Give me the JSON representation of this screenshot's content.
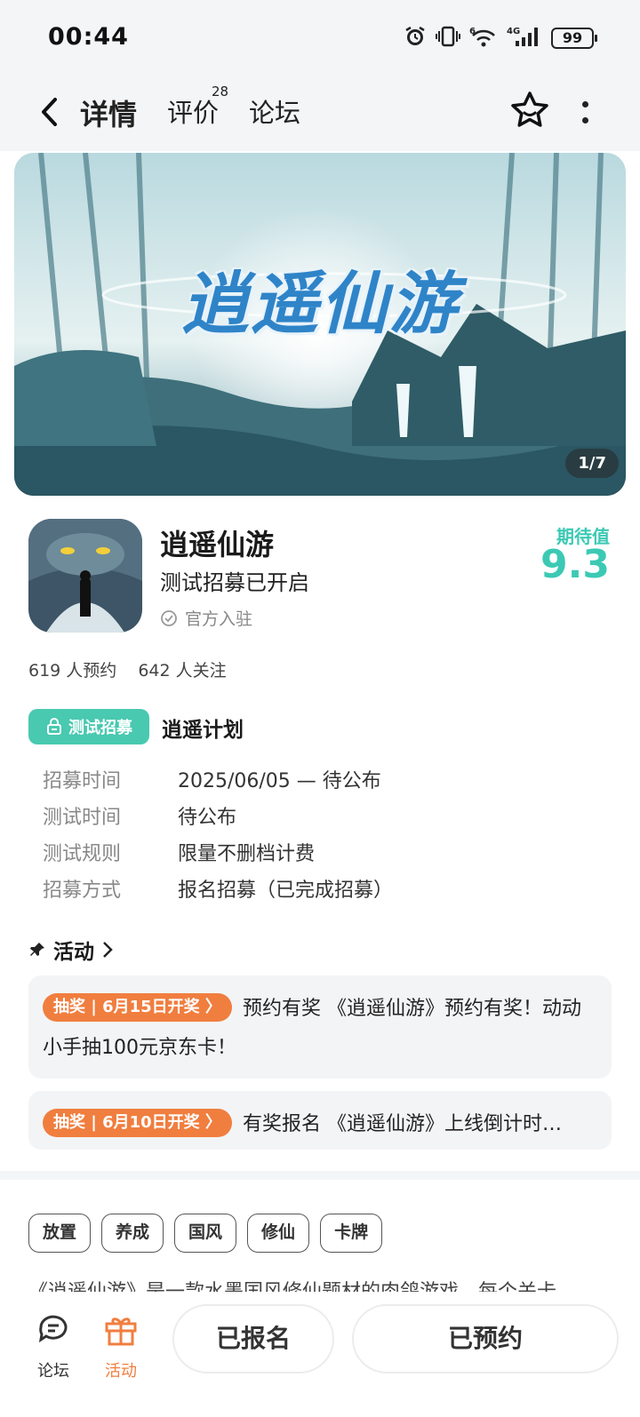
{
  "status_bar": {
    "time": "00:44",
    "battery": "99",
    "network": "4G",
    "wifi_gen": "6"
  },
  "nav": {
    "tab_detail": "详情",
    "tab_review": "评价",
    "review_count": "28",
    "tab_forum": "论坛"
  },
  "banner": {
    "title": "逍遥仙游",
    "counter": "1/7"
  },
  "app": {
    "name": "逍遥仙游",
    "subtitle": "测试招募已开启",
    "official": "官方入驻",
    "expect_label": "期待值",
    "expect_score": "9.3"
  },
  "stats": {
    "reservations": "619 人预约",
    "followers": "642 人关注"
  },
  "recruit": {
    "badge": "测试招募",
    "title": "逍遥计划",
    "rows": [
      {
        "key": "招募时间",
        "value": "2025/06/05 — 待公布"
      },
      {
        "key": "测试时间",
        "value": "待公布"
      },
      {
        "key": "测试规则",
        "value": "限量不删档计费"
      },
      {
        "key": "招募方式",
        "value": "报名招募（已完成招募）"
      }
    ]
  },
  "activity": {
    "heading": "活动",
    "items": [
      {
        "tag": "抽奖 | 6月15日开奖 〉",
        "text": "预约有奖 《逍遥仙游》预约有奖！动动小手抽100元京东卡！"
      },
      {
        "tag": "抽奖 | 6月10日开奖 〉",
        "text": "有奖报名 《逍遥仙游》上线倒计时…"
      }
    ]
  },
  "tags": [
    "放置",
    "养成",
    "国风",
    "修仙",
    "卡牌"
  ],
  "description": "《逍遥仙游》是一款水墨国风修仙题材的肉鸽游戏，每个关卡",
  "bottom": {
    "forum": "论坛",
    "activity": "活动",
    "signed_up": "已报名",
    "reserved": "已预约"
  },
  "colors": {
    "accent": "#3cc9b4",
    "lottery": "#f07e3f"
  }
}
